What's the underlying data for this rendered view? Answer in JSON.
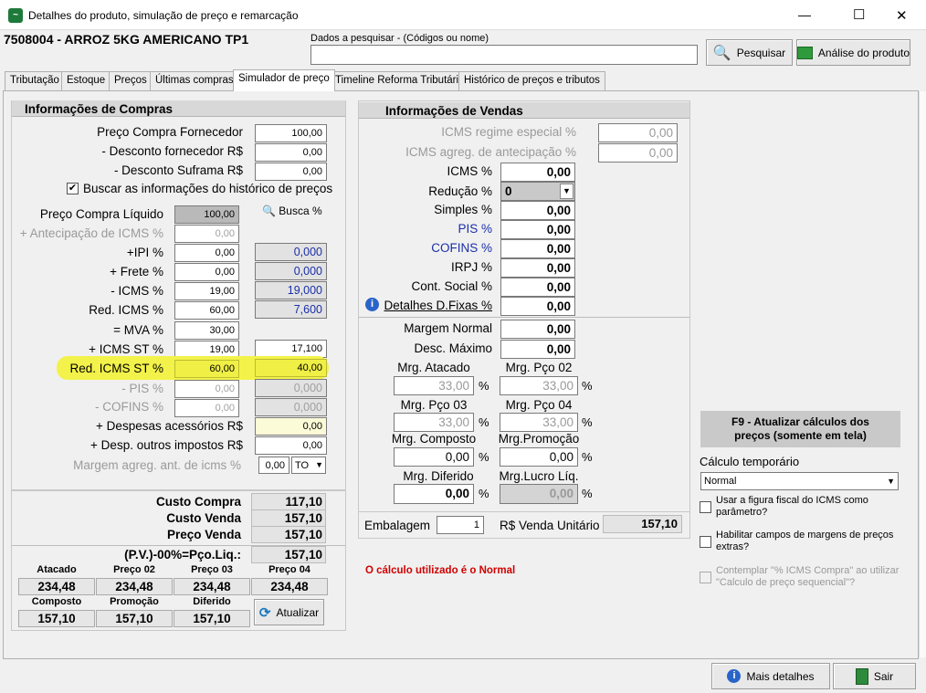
{
  "window": {
    "title": "Detalhes do produto, simulação de preço e remarcação",
    "minimize": "—",
    "maximize": "☐",
    "close": "✕"
  },
  "product": {
    "title": "7508004 - ARROZ  5KG AMERICANO TP1"
  },
  "search": {
    "label": "Dados a pesquisar - (Códigos ou nome)",
    "value": "",
    "button": "Pesquisar"
  },
  "analysis_button": "Análise do produto",
  "tabs": [
    "Tributação",
    "Estoque",
    "Preços",
    "Últimas compras",
    "Simulador de preço",
    "Timeline Reforma Tributária",
    "Histórico de preços e tributos"
  ],
  "compras": {
    "title": "Informações de Compras",
    "preco_compra_fornecedor": {
      "label": "Preço Compra Fornecedor",
      "value": "100,00"
    },
    "desconto_fornecedor": {
      "label": "- Desconto fornecedor R$",
      "value": "0,00"
    },
    "desconto_suframa": {
      "label": "- Desconto Suframa R$",
      "value": "0,00"
    },
    "buscar_historico": {
      "label": "Buscar as informações do histórico de preços",
      "checked": "✔"
    },
    "preco_compra_liquido": {
      "label": "Preço Compra Líquido",
      "value": "100,00"
    },
    "busca_pct": "Busca %",
    "antecipacao_icms": {
      "label": "+ Antecipação de ICMS %",
      "value": "0,00"
    },
    "ipi": {
      "label": "+IPI %",
      "value": "0,00",
      "calc": "0,000"
    },
    "frete": {
      "label": "+ Frete %",
      "value": "0,00",
      "calc": "0,000"
    },
    "icms": {
      "label": "- ICMS %",
      "value": "19,00",
      "calc": "19,000"
    },
    "red_icms": {
      "label": "Red. ICMS %",
      "value": "60,00",
      "calc": "7,600"
    },
    "mva": {
      "label": "= MVA %",
      "value": "30,00"
    },
    "icms_st": {
      "label": "+ ICMS ST %",
      "value": "19,00",
      "calc": "17,100"
    },
    "red_icms_st": {
      "label": "Red. ICMS ST %",
      "value": "60,00",
      "calc": "40,00"
    },
    "pis": {
      "label": "- PIS %",
      "value": "0,00",
      "calc": "0,000"
    },
    "cofins": {
      "label": "- COFINS %",
      "value": "0,00",
      "calc": "0,000"
    },
    "despesas_acessorias": {
      "label": "+ Despesas acessórios R$",
      "value": "0,00"
    },
    "desp_outros_impostos": {
      "label": "+ Desp. outros impostos R$",
      "value": "0,00"
    },
    "margem_agreg": {
      "label": "Margem agreg. ant. de icms %",
      "value": "0,00",
      "select": "TO"
    }
  },
  "totais": {
    "custo_compra": {
      "label": "Custo Compra",
      "value": "117,10"
    },
    "custo_venda": {
      "label": "Custo Venda",
      "value": "157,10"
    },
    "preco_venda": {
      "label": "Preço Venda",
      "value": "157,10"
    },
    "pv_liq": {
      "label": "(P.V.)-00%=Pço.Liq.:",
      "value": "157,10"
    },
    "atacado": {
      "label": "Atacado",
      "value": "234,48"
    },
    "preco02": {
      "label": "Preço 02",
      "value": "234,48"
    },
    "preco03": {
      "label": "Preço 03",
      "value": "234,48"
    },
    "preco04": {
      "label": "Preço 04",
      "value": "234,48"
    },
    "composto": {
      "label": "Composto",
      "value": "157,10"
    },
    "promocao": {
      "label": "Promoção",
      "value": "157,10"
    },
    "diferido": {
      "label": "Diferido",
      "value": "157,10"
    },
    "atualizar": "Atualizar"
  },
  "vendas": {
    "title": "Informações de Vendas",
    "icms_regime": {
      "label": "ICMS regime especial %",
      "value": "0,00"
    },
    "icms_agreg": {
      "label": "ICMS agreg. de antecipação %",
      "value": "0,00"
    },
    "icms": {
      "label": "ICMS %",
      "value": "0,00"
    },
    "reducao": {
      "label": "Redução %",
      "value": "0"
    },
    "simples": {
      "label": "Simples %",
      "value": "0,00"
    },
    "pis": {
      "label": "PIS %",
      "value": "0,00"
    },
    "cofins": {
      "label": "COFINS %",
      "value": "0,00"
    },
    "irpj": {
      "label": "IRPJ %",
      "value": "0,00"
    },
    "cont_social": {
      "label": "Cont. Social %",
      "value": "0,00"
    },
    "detalhes": {
      "label": "Detalhes D.Fixas %",
      "value": "0,00"
    },
    "margem_normal": {
      "label": "Margem Normal",
      "value": "0,00"
    },
    "desc_maximo": {
      "label": "Desc. Máximo",
      "value": "0,00"
    },
    "mrg_atacado": {
      "label": "Mrg. Atacado",
      "value": "33,00"
    },
    "mrg_pco02": {
      "label": "Mrg. Pço 02",
      "value": "33,00"
    },
    "mrg_pco03": {
      "label": "Mrg. Pço 03",
      "value": "33,00"
    },
    "mrg_pco04": {
      "label": "Mrg. Pço 04",
      "value": "33,00"
    },
    "mrg_composto": {
      "label": "Mrg. Composto",
      "value": "0,00"
    },
    "mrg_promocao": {
      "label": "Mrg.Promoção",
      "value": "0,00"
    },
    "mrg_diferido": {
      "label": "Mrg. Diferido",
      "value": "0,00"
    },
    "mrg_lucro_liq": {
      "label": "Mrg.Lucro Líq.",
      "value": "0,00"
    },
    "pct": "%",
    "embalagem": {
      "label": "Embalagem",
      "value": "1"
    },
    "venda_unitario": {
      "label": "R$ Venda Unitário",
      "value": "157,10"
    },
    "calc_msg": "O cálculo utilizado é o Normal"
  },
  "right": {
    "f9": "F9 - Atualizar cálculos dos preços (somente em tela)",
    "calc_temp_label": "Cálculo temporário",
    "calc_temp_value": "Normal",
    "opt1": "Usar a figura fiscal do ICMS como parâmetro?",
    "opt2": "Habilitar campos de margens de preços extras?",
    "opt3": "Contemplar \"% ICMS Compra\" ao utilizar \"Calculo de preço sequencial\"?"
  },
  "footer": {
    "mais_detalhes": "Mais detalhes",
    "sair": "Sair"
  }
}
